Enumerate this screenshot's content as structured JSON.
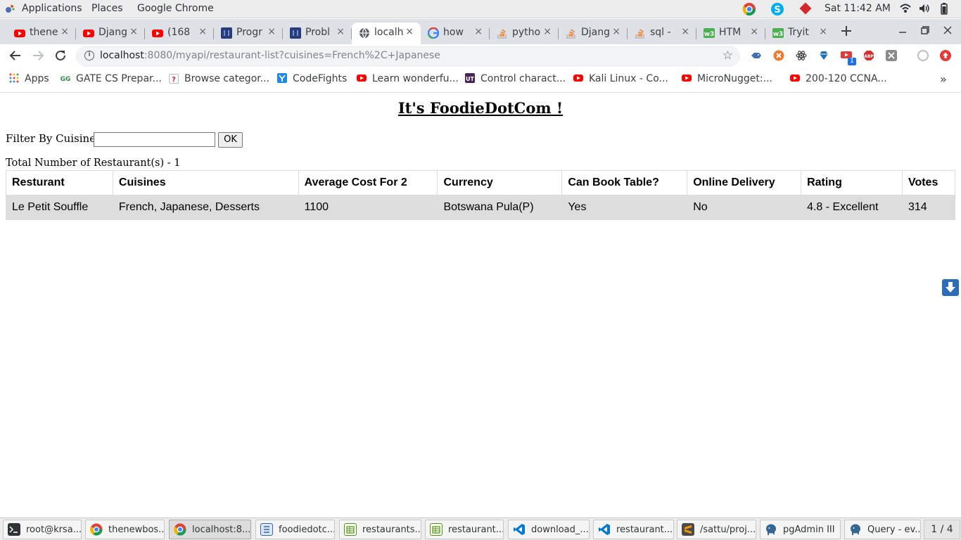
{
  "topbar": {
    "applications": "Applications",
    "places": "Places",
    "active_app": "Google Chrome",
    "clock": "Sat 11:42 AM"
  },
  "tabs": [
    {
      "title": "thene",
      "favicon": "youtube-icon"
    },
    {
      "title": "Djang",
      "favicon": "youtube-icon"
    },
    {
      "title": "(168",
      "favicon": "youtube-icon"
    },
    {
      "title": "Progr",
      "favicon": "code-icon"
    },
    {
      "title": "Probl",
      "favicon": "code-icon"
    },
    {
      "title": "localh",
      "favicon": "globe-icon"
    },
    {
      "title": "how",
      "favicon": "google-icon"
    },
    {
      "title": "pytho",
      "favicon": "stackoverflow-icon"
    },
    {
      "title": "Djang",
      "favicon": "stackoverflow-icon"
    },
    {
      "title": "sql -",
      "favicon": "stackoverflow-icon"
    },
    {
      "title": "HTM",
      "favicon": "w3schools-icon"
    },
    {
      "title": "Tryit",
      "favicon": "w3schools-icon"
    }
  ],
  "address": {
    "host": "localhost",
    "path": ":8080/myapi/restaurant-list?cuisines=French%2C+Japanese"
  },
  "extensions": {
    "badge": "1"
  },
  "bookmarks": [
    {
      "label": "Apps"
    },
    {
      "label": "GATE CS Prepar..."
    },
    {
      "label": "Browse categor..."
    },
    {
      "label": "CodeFights"
    },
    {
      "label": "Learn wonderfu..."
    },
    {
      "label": "Control charact..."
    },
    {
      "label": "Kali Linux - Co..."
    },
    {
      "label": "MicroNugget:..."
    },
    {
      "label": "200-120 CCNA..."
    }
  ],
  "page": {
    "heading": "It's FoodieDotCom !",
    "filter_label": "Filter By Cuisines:",
    "filter_value": "",
    "ok_label": "OK",
    "total_text": "Total Number of Restaurant(s) - 1",
    "columns": [
      "Resturant",
      "Cuisines",
      "Average Cost For 2",
      "Currency",
      "Can Book Table?",
      "Online Delivery",
      "Rating",
      "Votes"
    ],
    "rows": [
      [
        "Le Petit Souffle",
        "French, Japanese, Desserts",
        "1100",
        "Botswana Pula(P)",
        "Yes",
        "No",
        "4.8 - Excellent",
        "314"
      ]
    ]
  },
  "taskbar": {
    "items": [
      {
        "label": "root@krsa..."
      },
      {
        "label": "thenewbos..."
      },
      {
        "label": "localhost:8..."
      },
      {
        "label": "foodiedotc..."
      },
      {
        "label": "restaurants..."
      },
      {
        "label": "restaurant..."
      },
      {
        "label": "download_..."
      },
      {
        "label": "restaurant..."
      },
      {
        "label": "/sattu/proj..."
      },
      {
        "label": "pgAdmin III"
      },
      {
        "label": "Query - ev..."
      }
    ],
    "workspace": "1 / 4"
  }
}
